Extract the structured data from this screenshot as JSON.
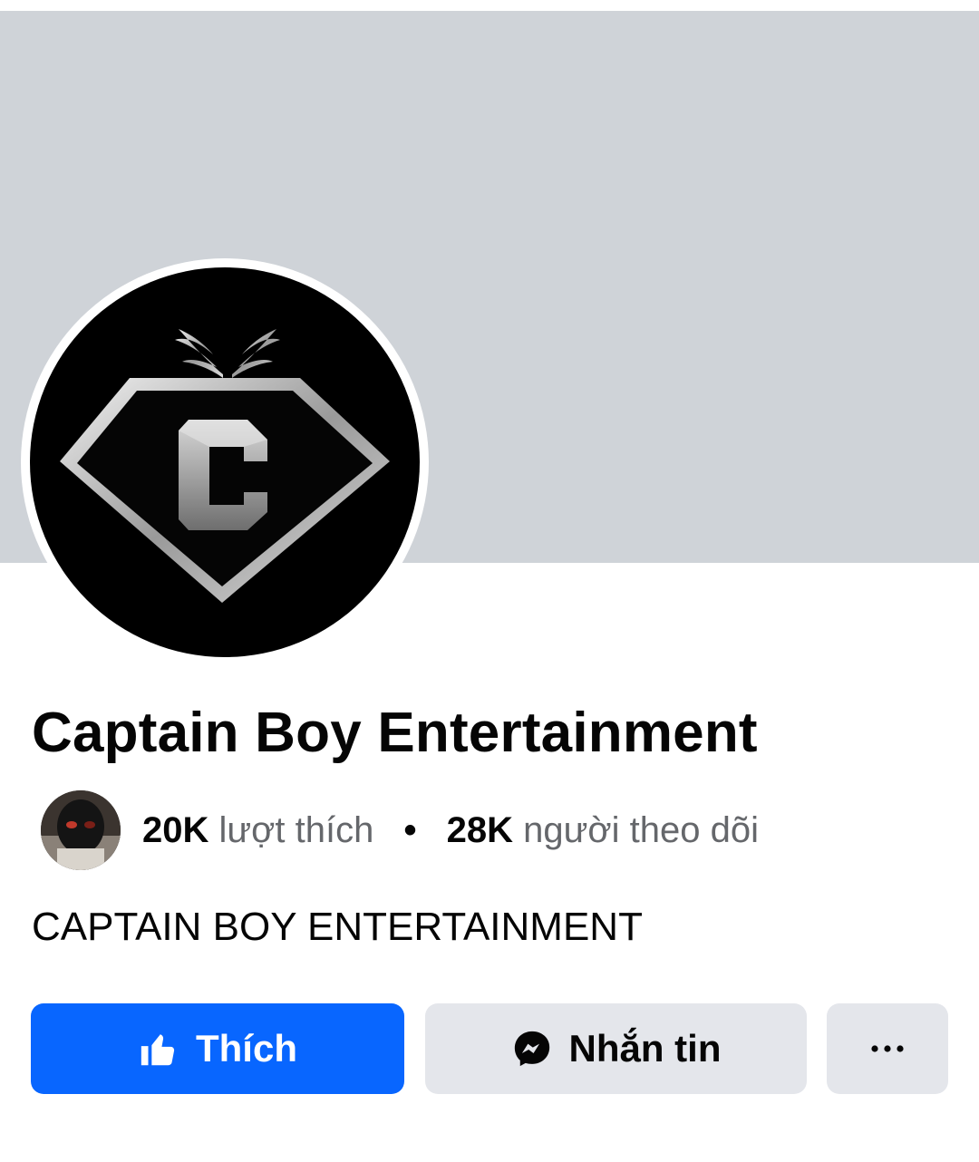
{
  "page": {
    "name": "Captain Boy Entertainment",
    "description": "CAPTAIN BOY ENTERTAINMENT"
  },
  "stats": {
    "likes_count": "20K",
    "likes_label": "lượt thích",
    "separator": "•",
    "followers_count": "28K",
    "followers_label": "người theo dõi"
  },
  "actions": {
    "like_label": "Thích",
    "message_label": "Nhắn tin",
    "more_label": "···"
  },
  "icons": {
    "like": "thumbs-up-icon",
    "message": "messenger-icon",
    "more": "more-dots-icon",
    "profile_logo": "winged-diamond-c-logo",
    "friend_avatar": "masked-person-avatar"
  },
  "colors": {
    "cover": "#cfd3d8",
    "primary_button": "#0866ff",
    "secondary_button": "#e4e6eb",
    "secondary_text": "#65676b",
    "primary_text": "#050505"
  }
}
